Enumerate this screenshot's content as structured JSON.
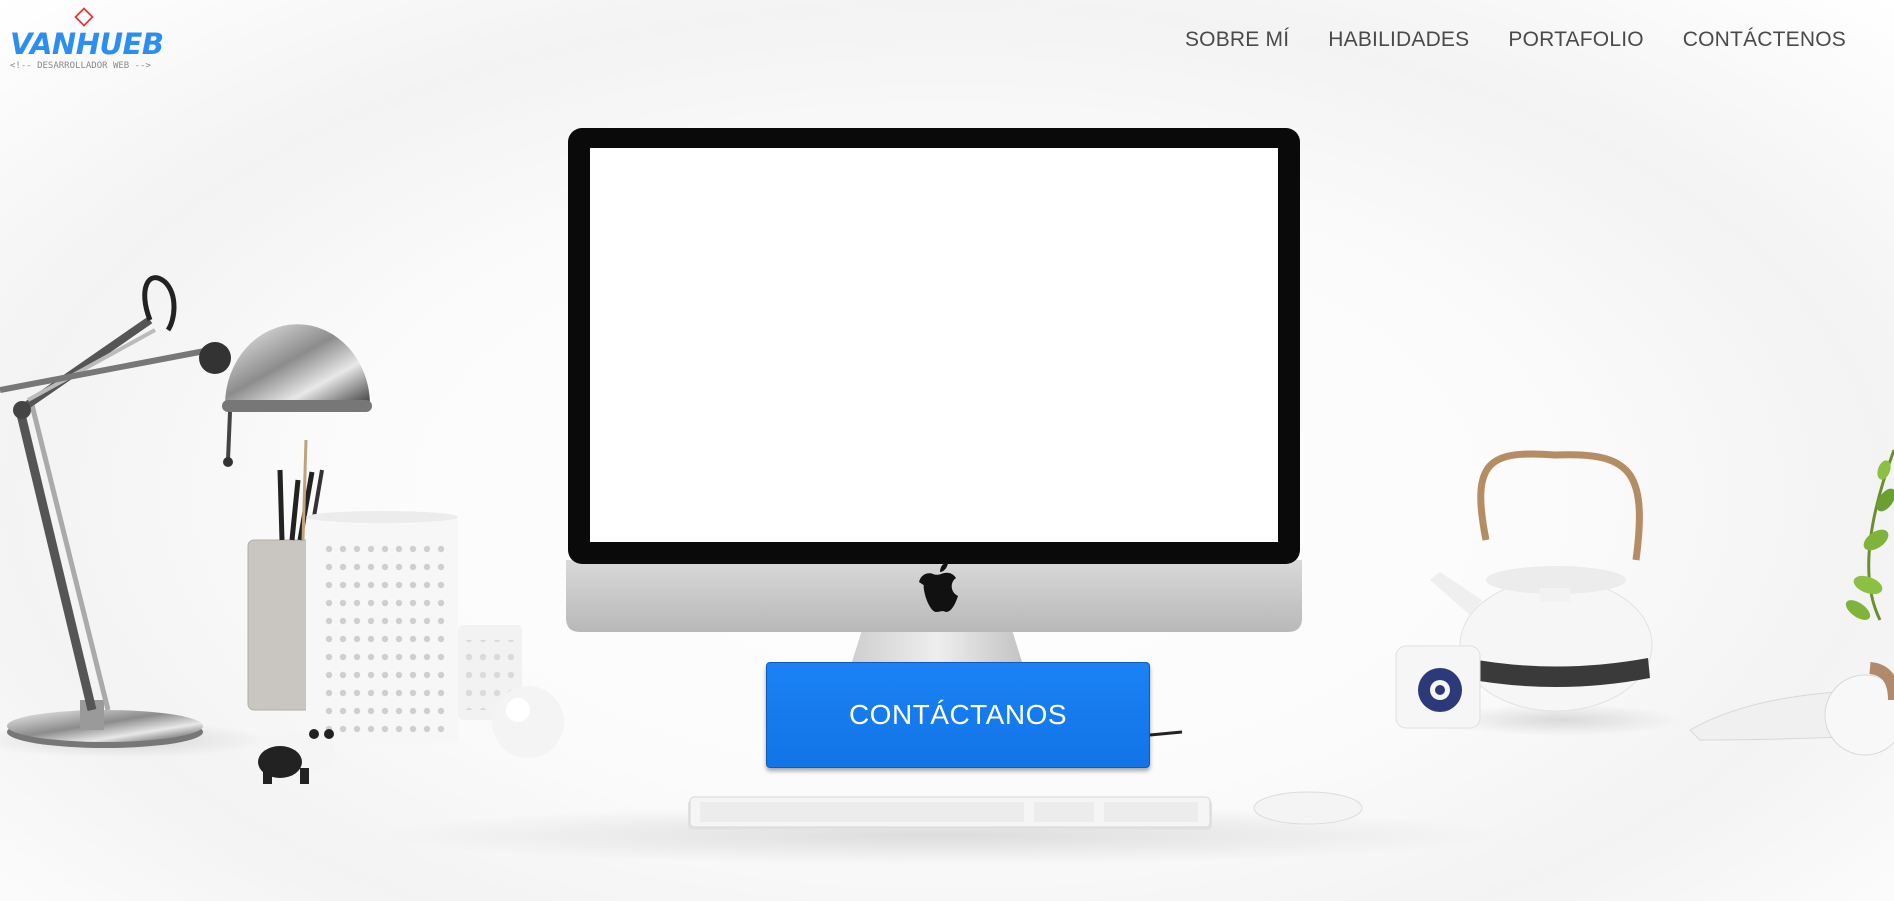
{
  "logo": {
    "title": "VANHUEB",
    "subtitle": "<!-- DESARROLLADOR WEB -->",
    "mark_color": "#e0393e",
    "title_color": "#2c8ef0"
  },
  "nav": {
    "items": [
      {
        "label": "SOBRE MÍ"
      },
      {
        "label": "HABILIDADES"
      },
      {
        "label": "PORTAFOLIO"
      },
      {
        "label": "CONTÁCTENOS"
      }
    ]
  },
  "hero": {
    "cta_label": "CONTÁCTANOS",
    "accent": "#1a82f5"
  }
}
